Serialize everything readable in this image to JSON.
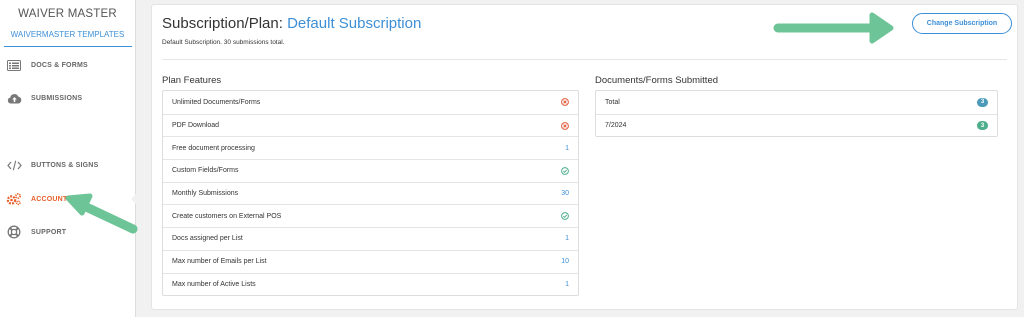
{
  "sidebar": {
    "brand_title": "WAIVER MASTER",
    "brand_sub": "WAIVERMASTER TEMPLATES",
    "items": [
      {
        "label": "DOCS & FORMS",
        "icon": "list-icon"
      },
      {
        "label": "SUBMISSIONS",
        "icon": "cloud-upload-icon"
      },
      {
        "label": "BUTTONS & SIGNS",
        "icon": "code-icon"
      },
      {
        "label": "ACCOUNT",
        "icon": "gears-icon",
        "active": true
      },
      {
        "label": "SUPPORT",
        "icon": "lifebuoy-icon"
      }
    ]
  },
  "main": {
    "title_prefix": "Subscription/Plan: ",
    "plan_name": "Default Subscription",
    "description": "Default Subscription. 30 submissions total.",
    "change_button": "Change Subscription",
    "plan_features_title": "Plan Features",
    "features": [
      {
        "label": "Unlimited Documents/Forms",
        "status": "no"
      },
      {
        "label": "PDF Download",
        "status": "no"
      },
      {
        "label": "Free document processing",
        "value": "1"
      },
      {
        "label": "Custom Fields/Forms",
        "status": "yes"
      },
      {
        "label": "Monthly Submissions",
        "value": "30"
      },
      {
        "label": "Create customers on External POS",
        "status": "yes"
      },
      {
        "label": "Docs assigned per List",
        "value": "1"
      },
      {
        "label": "Max number of Emails per List",
        "value": "10"
      },
      {
        "label": "Max number of Active Lists",
        "value": "1"
      }
    ],
    "submitted_title": "Documents/Forms Submitted",
    "submitted": [
      {
        "label": "Total",
        "count": "3",
        "color": "#4a9ab8"
      },
      {
        "label": "7/2024",
        "count": "3",
        "color": "#4fae8c"
      }
    ]
  },
  "colors": {
    "accent": "#3d8fd6",
    "active": "#e8612c",
    "no": "#e05a3a",
    "yes": "#4fae8c",
    "arrow": "#6cc497"
  }
}
